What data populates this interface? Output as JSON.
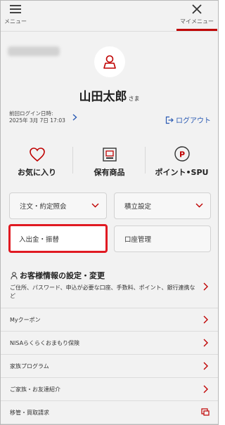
{
  "header": {
    "menu_label": "メニュー",
    "mypage_label": "マイメニュー"
  },
  "profile": {
    "name": "山田太郎",
    "honorific": "さま",
    "last_login_label": "前回ログイン日時:",
    "last_login_value": "2025年 3月 7日 17:03",
    "logout_label": "ログアウト"
  },
  "shortcuts": [
    {
      "label": "お気に入り",
      "icon": "heart-icon"
    },
    {
      "label": "保有商品",
      "icon": "holdings-icon"
    },
    {
      "label": "ポイント•SPU",
      "icon": "point-icon"
    }
  ],
  "actions": {
    "orders": "注文・約定照会",
    "accumulation": "積立設定",
    "deposit": "入出金・振替",
    "account": "口座管理"
  },
  "settings": {
    "title": "お客様情報の設定・変更",
    "description": "ご住所、パスワード、申込が必要な口座、手数料、ポイント、銀行連携など"
  },
  "list": {
    "coupon": "Myクーポン",
    "nisa": "NISAらくらくおまもり保険",
    "family": "家族プログラム",
    "referral": "ご家族・お友達紹介",
    "transfer": "移管・買取請求"
  },
  "colors": {
    "accent": "#bf0000",
    "selected_border": "#e01a22",
    "link": "#2a5ab3"
  }
}
